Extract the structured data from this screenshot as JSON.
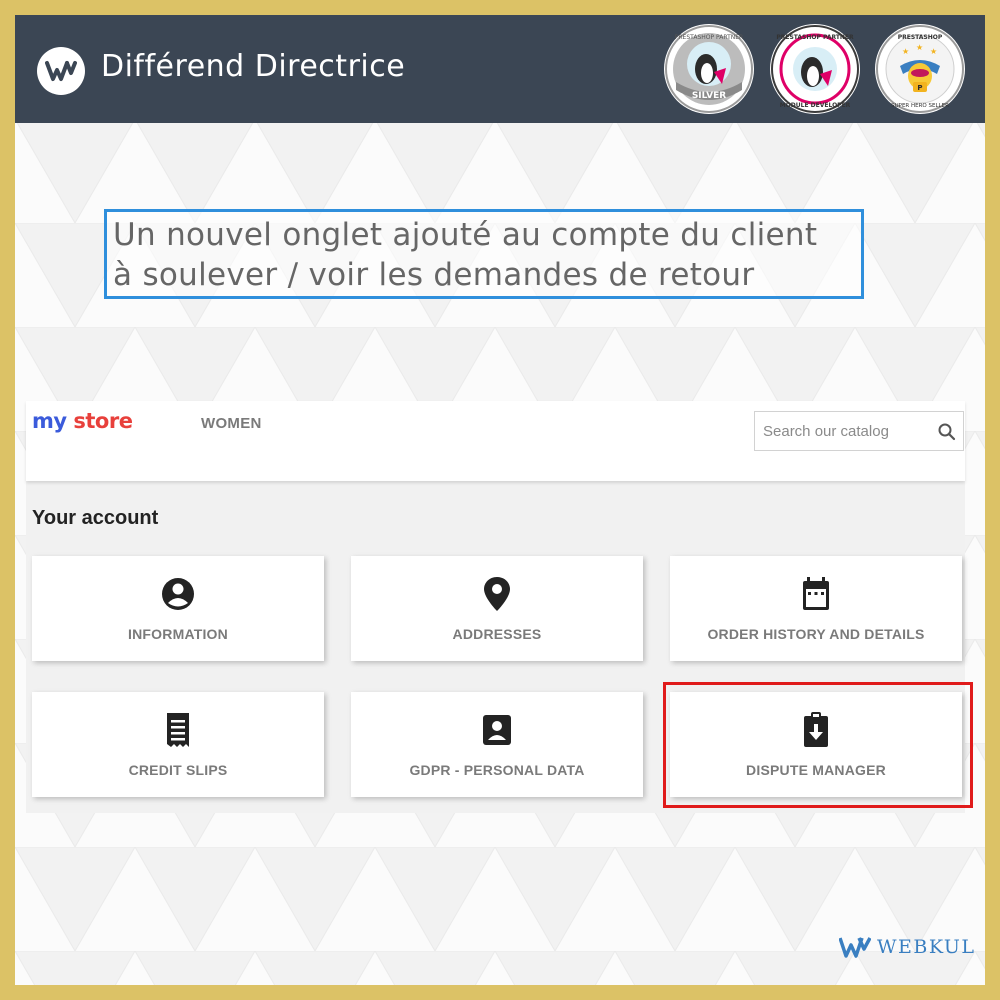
{
  "header": {
    "title": "Différend Directrice",
    "badges": [
      {
        "top_text": "PRESTASHOP PARTNER",
        "bottom_text": "SILVER"
      },
      {
        "top_text": "PRESTASHOP PARTNER",
        "bottom_text": "MODULE DEVELOPER"
      },
      {
        "top_text": "PRESTASHOP",
        "bottom_text": "SUPER HERO SELLER"
      }
    ]
  },
  "caption": {
    "line1": "Un nouvel onglet ajouté au compte du client",
    "line2": "à soulever / voir les demandes de retour"
  },
  "store": {
    "brand": {
      "part1": "my",
      "part2": "store"
    },
    "nav": {
      "women": "WOMEN"
    },
    "search": {
      "placeholder": "Search our catalog"
    },
    "account_title": "Your account",
    "tiles": [
      {
        "label": "INFORMATION",
        "icon": "user-circle-icon"
      },
      {
        "label": "ADDRESSES",
        "icon": "map-pin-icon"
      },
      {
        "label": "ORDER HISTORY AND DETAILS",
        "icon": "calendar-icon"
      },
      {
        "label": "CREDIT SLIPS",
        "icon": "receipt-icon"
      },
      {
        "label": "GDPR - PERSONAL DATA",
        "icon": "id-card-icon"
      },
      {
        "label": "DISPUTE MANAGER",
        "icon": "clipboard-download-icon"
      }
    ]
  },
  "footer": {
    "brand": "WEBKUL"
  },
  "colors": {
    "frame": "#dcc266",
    "header_bg": "#3b4654",
    "caption_border": "#2f8fdc",
    "highlight_border": "#e01b1b",
    "webkul_blue": "#3a7fc1"
  }
}
